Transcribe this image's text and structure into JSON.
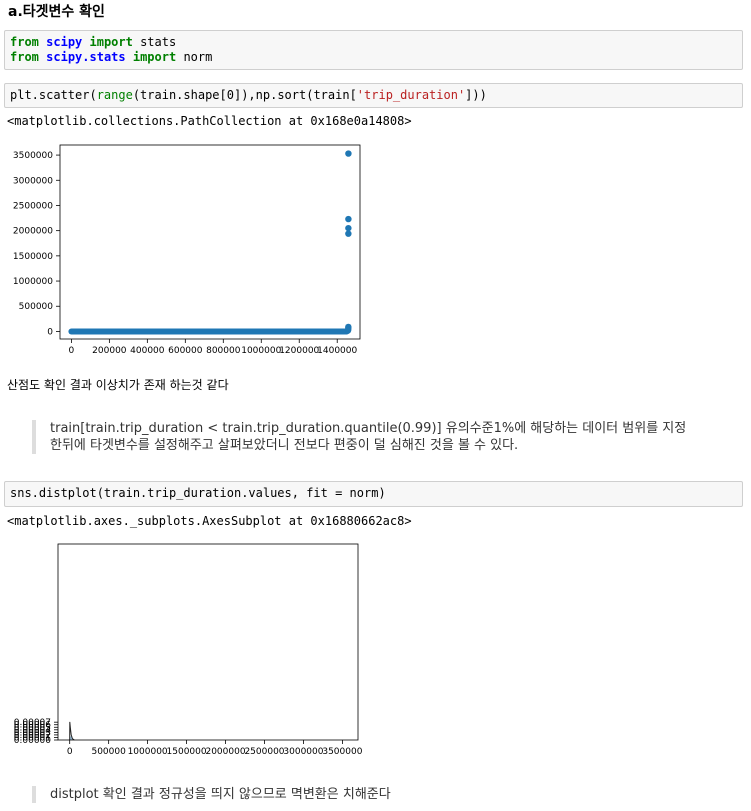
{
  "heading": "a.타겟변수 확인",
  "cell1": {
    "line1": {
      "k1": "from",
      "m1": "scipy",
      "k2": "import",
      "rest": " stats"
    },
    "line2": {
      "k1": "from",
      "m1": "scipy.stats",
      "k2": "import",
      "rest": " norm"
    }
  },
  "cell2": {
    "p1": "plt.scatter(",
    "fn": "range",
    "p2": "(train.shape[0]),np.sort(train[",
    "str": "'trip_duration'",
    "p3": "]))"
  },
  "out1": "<matplotlib.collections.PathCollection at 0x168e0a14808>",
  "md1": "산점도 확인 결과 이상치가 존재 하는것 같다",
  "quote1": {
    "line1": "train[train.trip_duration < train.trip_duration.quantile(0.99)] 유의수준1%에 해당하는 데이터 범위를 지정",
    "line2": "한뒤에 타겟변수를 설정해주고 살펴보았더니 전보다 편중이 덜 심해진 것을 볼 수 있다."
  },
  "cell3": "sns.distplot(train.trip_duration.values, fit = norm)",
  "out2": "<matplotlib.axes._subplots.AxesSubplot at 0x16880662ac8>",
  "quote2": "distplot 확인 결과 정규성을 띄지 않으므로 멱변환은 치해준다",
  "chart_data": [
    {
      "type": "scatter",
      "title": "",
      "xlabel": "",
      "ylabel": "",
      "xlim": [
        -60000,
        1520000
      ],
      "ylim": [
        -150000,
        3700000
      ],
      "xticks": [
        0,
        200000,
        400000,
        600000,
        800000,
        1000000,
        1200000,
        1400000
      ],
      "xtick_labels": [
        "0",
        "200000",
        "400000",
        "600000",
        "800000",
        "1000000",
        "1200000",
        "1400000"
      ],
      "yticks": [
        0,
        500000,
        1000000,
        1500000,
        2000000,
        2500000,
        3000000,
        3500000
      ],
      "ytick_labels": [
        "0",
        "500000",
        "1000000",
        "1500000",
        "2000000",
        "2500000",
        "3000000",
        "3500000"
      ],
      "color": "#1f77b4",
      "baseline": {
        "x_start": 0,
        "x_end": 1450000,
        "y": 0
      },
      "points": [
        {
          "x": 1457000,
          "y": 20000
        },
        {
          "x": 1458000,
          "y": 40000
        },
        {
          "x": 1458500,
          "y": 70000
        },
        {
          "x": 1458600,
          "y": 90000
        },
        {
          "x": 1458700,
          "y": 1940000
        },
        {
          "x": 1458800,
          "y": 2050000
        },
        {
          "x": 1458900,
          "y": 2230000
        },
        {
          "x": 1459000,
          "y": 3530000
        }
      ]
    },
    {
      "type": "bar",
      "title": "",
      "xlabel": "",
      "ylabel": "",
      "xlim": [
        -150000,
        3700000
      ],
      "ylim": [
        0,
        0.00077
      ],
      "xticks": [
        0,
        500000,
        1000000,
        1500000,
        2000000,
        2500000,
        3000000,
        3500000
      ],
      "xtick_labels": [
        "0",
        "500000",
        "1000000",
        "1500000",
        "2000000",
        "2500000",
        "3000000",
        "3500000"
      ],
      "yticks": [
        0,
        1e-05,
        2e-05,
        3e-05,
        4e-05,
        5e-05,
        6e-05,
        7e-05
      ],
      "ytick_labels": [
        "0.00000",
        "0.00001",
        "0.00002",
        "0.00003",
        "0.00004",
        "0.00005",
        "0.00006",
        "0.00007"
      ],
      "bar_color": "#9ec3df",
      "line_color": "#222222",
      "bars": [
        {
          "x0": 0,
          "x1": 35000,
          "value": 1.4e-05
        }
      ],
      "kde": [
        [
          0,
          0.0
        ],
        [
          2000,
          7.1e-05
        ],
        [
          8000,
          5e-05
        ],
        [
          20000,
          2e-05
        ],
        [
          35000,
          5e-06
        ],
        [
          60000,
          0.0
        ]
      ]
    }
  ]
}
